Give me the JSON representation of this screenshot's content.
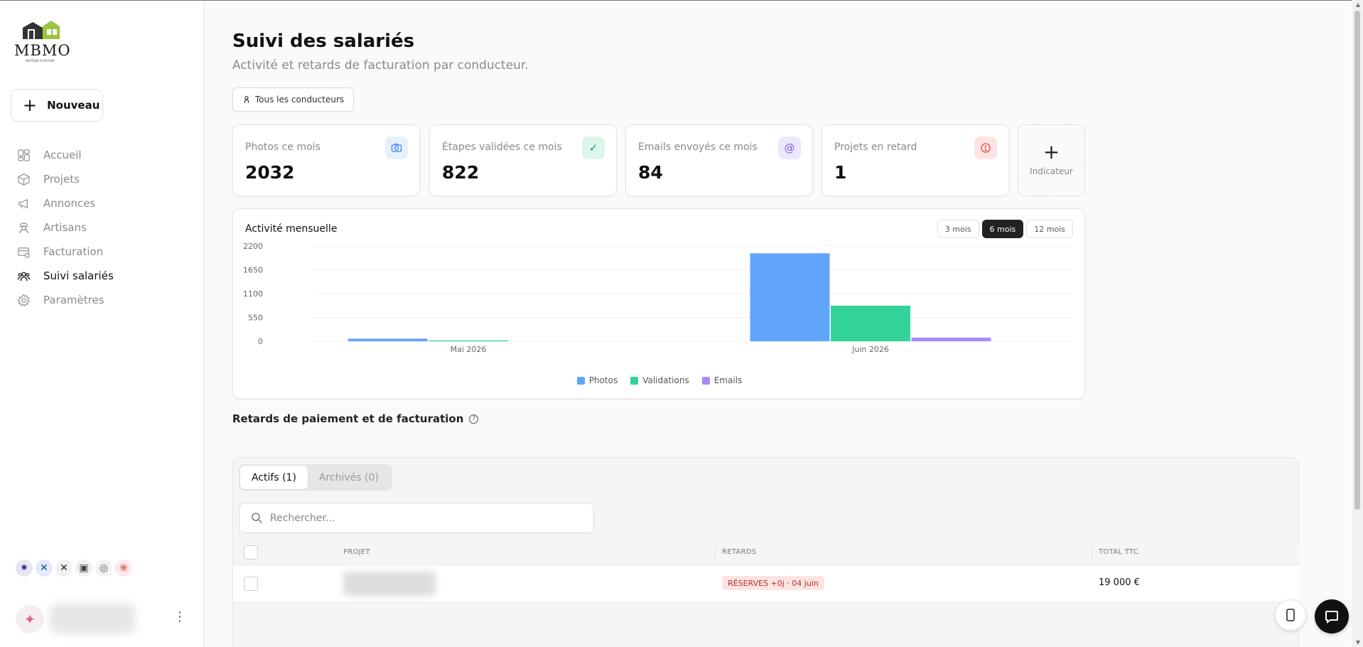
{
  "sidebar": {
    "logo_text": "MBMO",
    "logo_sub": "MAITRISE D'OEUVRE",
    "new_button": "Nouveau",
    "nav": [
      {
        "label": "Accueil",
        "icon": "dashboard-icon",
        "active": false
      },
      {
        "label": "Projets",
        "icon": "box-icon",
        "active": false
      },
      {
        "label": "Annonces",
        "icon": "megaphone-icon",
        "active": false
      },
      {
        "label": "Artisans",
        "icon": "worker-icon",
        "active": false
      },
      {
        "label": "Facturation",
        "icon": "invoice-icon",
        "active": false
      },
      {
        "label": "Suivi salariés",
        "icon": "users-icon",
        "active": true
      },
      {
        "label": "Paramètres",
        "icon": "gear-icon",
        "active": false
      }
    ]
  },
  "header": {
    "title": "Suivi des salariés",
    "subtitle": "Activité et retards de facturation par conducteur.",
    "filter": "Tous les conducteurs"
  },
  "kpis": [
    {
      "label": "Photos ce mois",
      "value": "2032",
      "icon": "camera-icon",
      "glyph": "📷",
      "bg": "#e6f0fd",
      "fg": "#3b82f6"
    },
    {
      "label": "Étapes validées ce mois",
      "value": "822",
      "icon": "check-icon",
      "glyph": "✓",
      "bg": "#dcf6ea",
      "fg": "#16a36a"
    },
    {
      "label": "Emails envoyés ce mois",
      "value": "84",
      "icon": "at-icon",
      "glyph": "@",
      "bg": "#ede8fd",
      "fg": "#7c5ce0"
    },
    {
      "label": "Projets en retard",
      "value": "1",
      "icon": "alert-icon",
      "glyph": "!",
      "bg": "#fde4e2",
      "fg": "#e0483b"
    }
  ],
  "add_indicator": "Indicateur",
  "chart": {
    "title": "Activité mensuelle",
    "periods": [
      "3 mois",
      "6 mois",
      "12 mois"
    ],
    "active_period": "6 mois"
  },
  "chart_data": {
    "type": "bar",
    "categories": [
      "Mai 2026",
      "Juin 2026"
    ],
    "series": [
      {
        "name": "Photos",
        "values": [
          60,
          2032
        ],
        "color": "#60a5fa"
      },
      {
        "name": "Validations",
        "values": [
          20,
          822
        ],
        "color": "#34d399"
      },
      {
        "name": "Emails",
        "values": [
          0,
          84
        ],
        "color": "#a78bfa"
      }
    ],
    "yticks": [
      0,
      550,
      1100,
      1650,
      2200
    ],
    "ylim": [
      0,
      2200
    ]
  },
  "delays": {
    "title": "Retards de paiement et de facturation",
    "tabs": [
      "Actifs (1)",
      "Archivés (0)"
    ],
    "search_placeholder": "Rechercher...",
    "columns": [
      "PROJET",
      "RETARDS",
      "TOTAL TTC"
    ],
    "rows": [
      {
        "badge": "RÉSERVES +0j · 04 juin",
        "total": "19 000 €"
      }
    ]
  }
}
